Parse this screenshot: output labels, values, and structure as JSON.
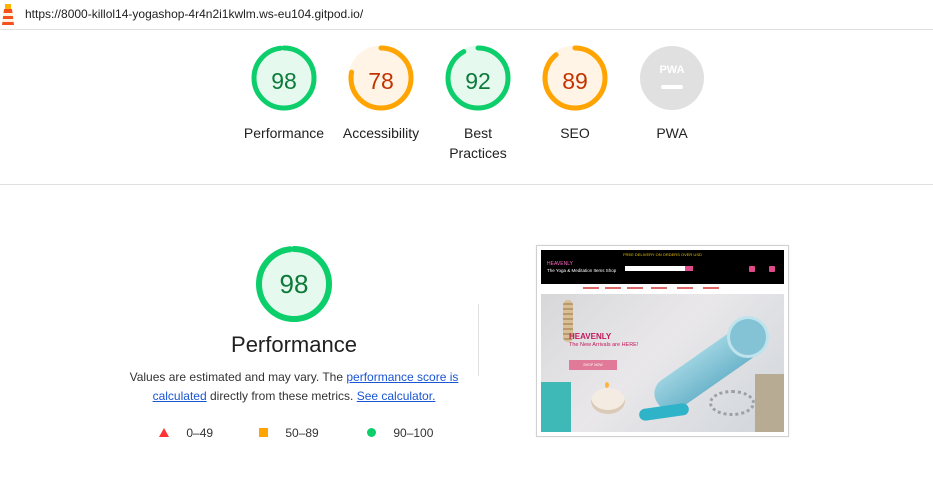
{
  "url": "https://8000-killol14-yogashop-4r4n2i1kwlm.ws-eu104.gitpod.io/",
  "colors": {
    "good": "#0cce6b",
    "average": "#ffa400",
    "poor": "#ff3333",
    "neutral": "#e0e0e0"
  },
  "categories": [
    {
      "score": "98",
      "label": "Performance",
      "rating": "good",
      "value": 0.98
    },
    {
      "score": "78",
      "label": "Accessibility",
      "rating": "average",
      "value": 0.78
    },
    {
      "score": "92",
      "label": "Best Practices",
      "rating": "good",
      "value": 0.92
    },
    {
      "score": "89",
      "label": "SEO",
      "rating": "average",
      "value": 0.89
    },
    {
      "score": "PWA",
      "label": "PWA",
      "rating": "neutral",
      "value": 0
    }
  ],
  "detail": {
    "score": "98",
    "value": 0.98,
    "title": "Performance",
    "note_prefix": "Values are estimated and may vary. The ",
    "note_link1": "performance score is calculated",
    "note_middle": " directly from these metrics. ",
    "note_link2": "See calculator."
  },
  "legend": [
    {
      "icon": "triangle-icon",
      "range": "0–49"
    },
    {
      "icon": "square-icon",
      "range": "50–89"
    },
    {
      "icon": "circle-icon",
      "range": "90–100"
    }
  ],
  "screenshot": {
    "banner": "FREE DELIVERY ON ORDERS OVER USD",
    "brand": "HEAVENLY",
    "tagline": "The Yoga & Meditation Items Shop",
    "hero_title": "HEAVENLY",
    "hero_subtitle": "The New Arrivals are HERE!",
    "hero_button": "SHOP NOW"
  }
}
